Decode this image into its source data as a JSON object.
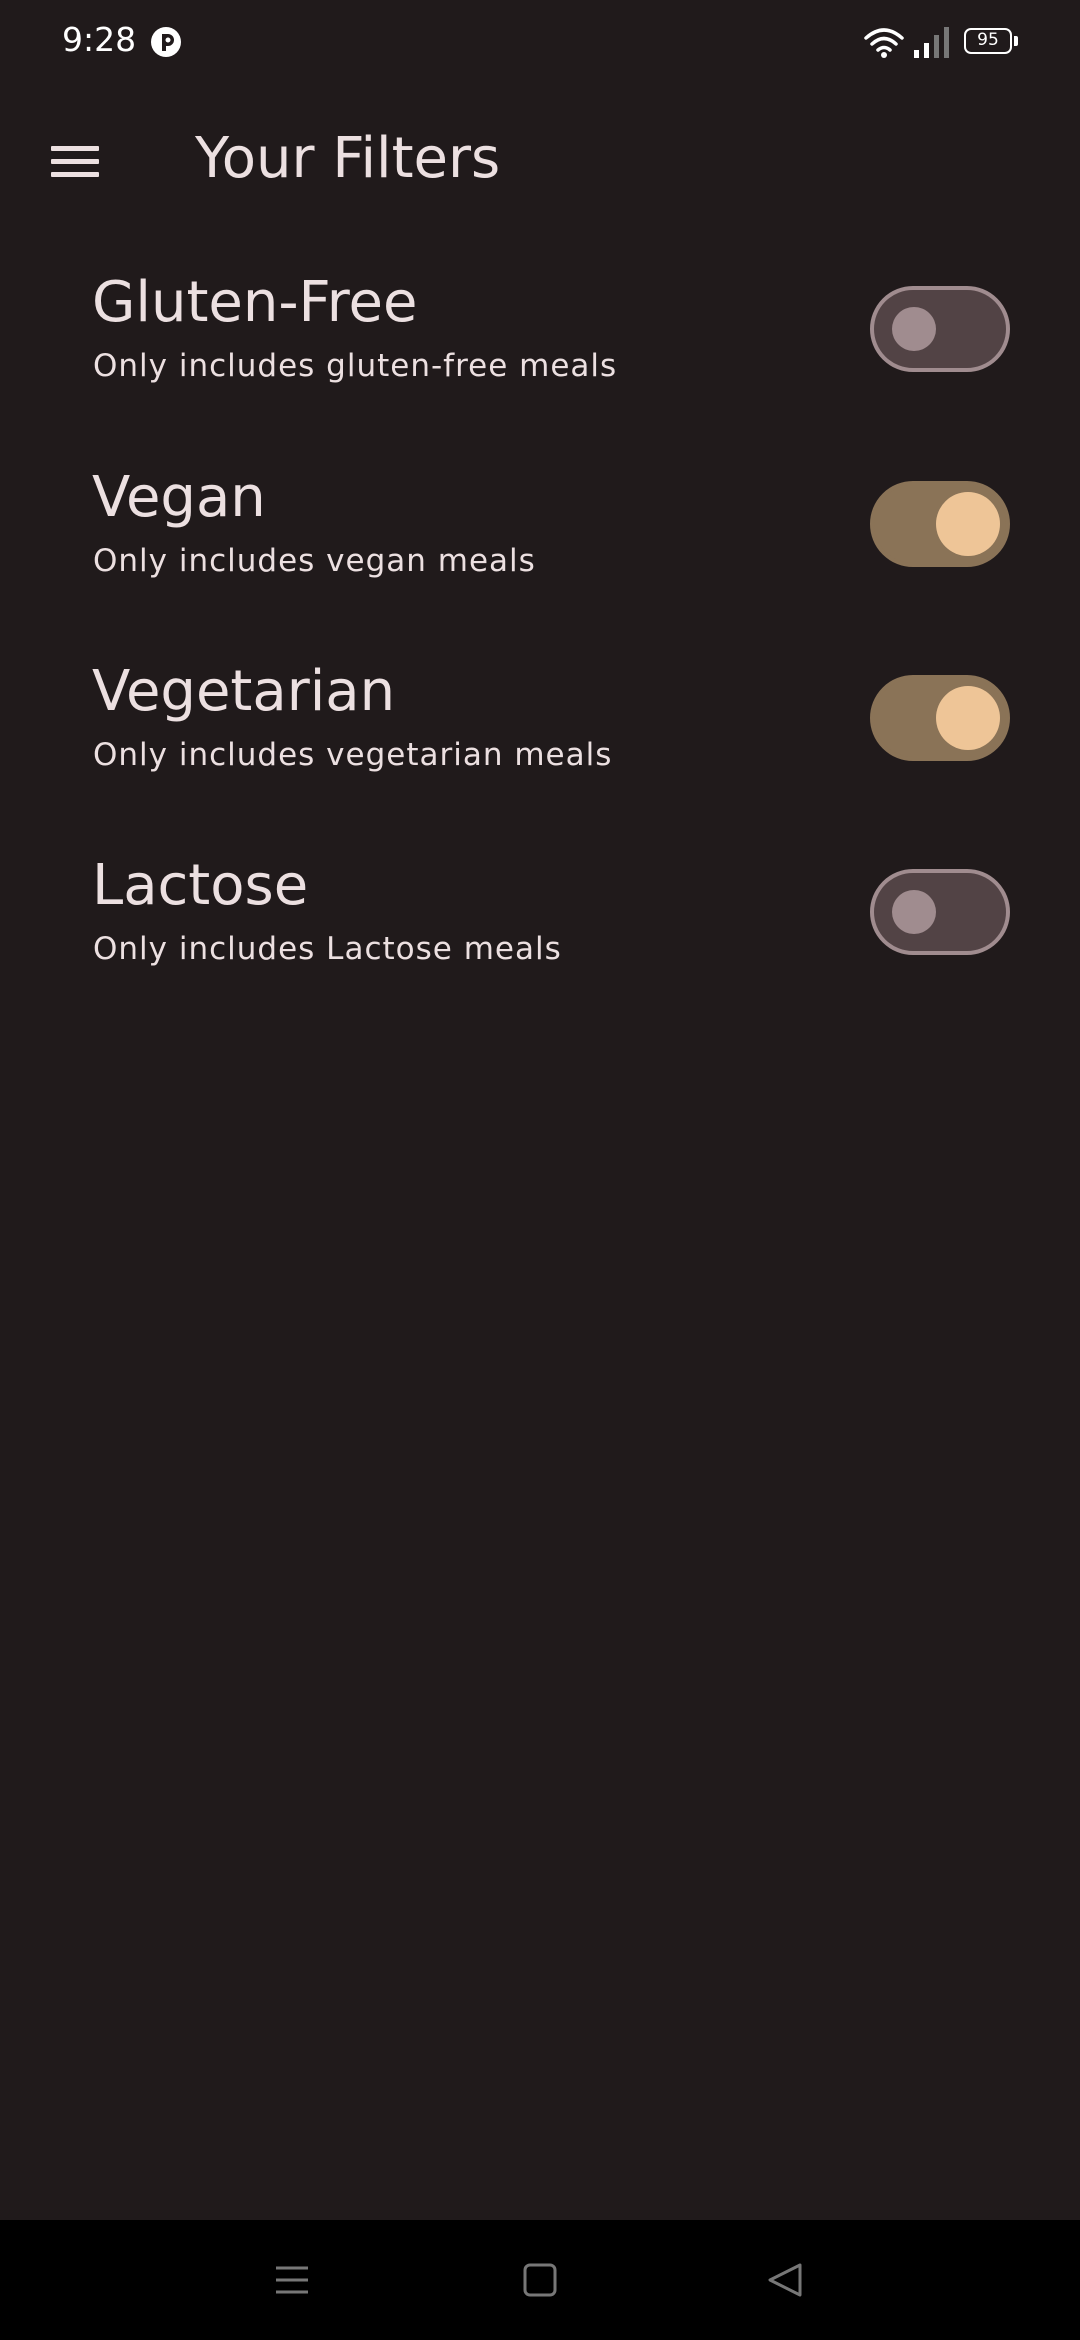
{
  "status_bar": {
    "time": "9:28",
    "battery_level": "95",
    "icons": [
      "app-notification-icon",
      "wifi-icon",
      "signal-icon",
      "battery-icon"
    ]
  },
  "app_bar": {
    "title": "Your Filters",
    "menu_icon": "hamburger-menu-icon"
  },
  "filters": [
    {
      "title": "Gluten-Free",
      "subtitle": "Only includes gluten-free meals",
      "enabled": false
    },
    {
      "title": "Vegan",
      "subtitle": "Only includes vegan meals",
      "enabled": true
    },
    {
      "title": "Vegetarian",
      "subtitle": "Only includes vegetarian meals",
      "enabled": true
    },
    {
      "title": "Lactose",
      "subtitle": "Only includes Lactose meals",
      "enabled": false
    }
  ],
  "nav_bar": {
    "buttons": [
      "recent-apps-icon",
      "home-icon",
      "back-icon"
    ]
  },
  "colors": {
    "background": "#201a1b",
    "text": "#ece0e1",
    "switch_on_track": "#8a7357",
    "switch_on_thumb": "#eec597",
    "switch_off_track": "#524345",
    "switch_off_outline": "#a08c8f",
    "nav_bar": "#000000"
  }
}
